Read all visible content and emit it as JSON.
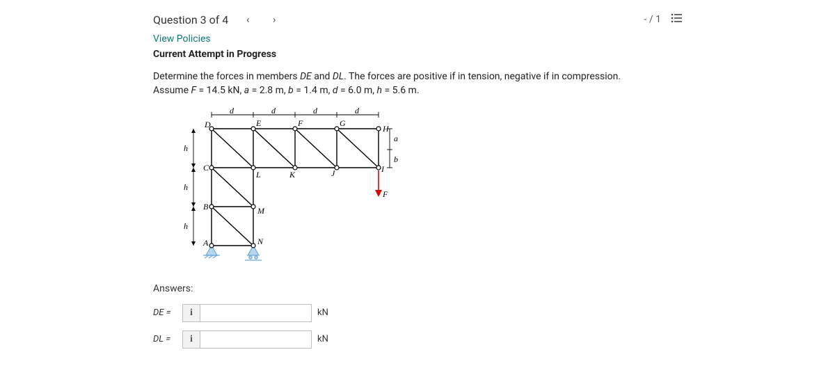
{
  "header": {
    "question_label": "Question 3 of 4",
    "score": "- / 1"
  },
  "links": {
    "view_policies": "View Policies"
  },
  "status": {
    "attempt": "Current Attempt in Progress"
  },
  "prompt": {
    "line1_a": "Determine the forces in members ",
    "line1_b": " and ",
    "line1_c": ". The forces are positive if in tension, negative if in compression.",
    "em_DE": "DE",
    "em_DL": "DL",
    "line2_a": "Assume ",
    "em_F": "F",
    "line2_b": " = 14.5 kN, ",
    "em_a": "a",
    "line2_c": " = 2.8 m, ",
    "em_b": "b",
    "line2_d": " = 1.4 m, ",
    "em_d": "d",
    "line2_e": " = 6.0 m, ",
    "em_h": "h",
    "line2_f": " = 5.6 m."
  },
  "figure": {
    "d1": "d",
    "d2": "d",
    "d3": "d",
    "d4": "d",
    "h1": "h",
    "h2": "h",
    "h3": "h",
    "label_a": "a",
    "label_b": "b",
    "label_F": "F",
    "D": "D",
    "E": "E",
    "F": "F",
    "G": "G",
    "H": "H",
    "I": "I",
    "J": "J",
    "K": "K",
    "L": "L",
    "C": "C",
    "B": "B",
    "M": "M",
    "A": "A",
    "N": "N"
  },
  "answers": {
    "title": "Answers:",
    "rows": [
      {
        "label": "DE =",
        "info": "i",
        "value": "",
        "unit": "kN"
      },
      {
        "label": "DL =",
        "info": "i",
        "value": "",
        "unit": "kN"
      }
    ]
  }
}
